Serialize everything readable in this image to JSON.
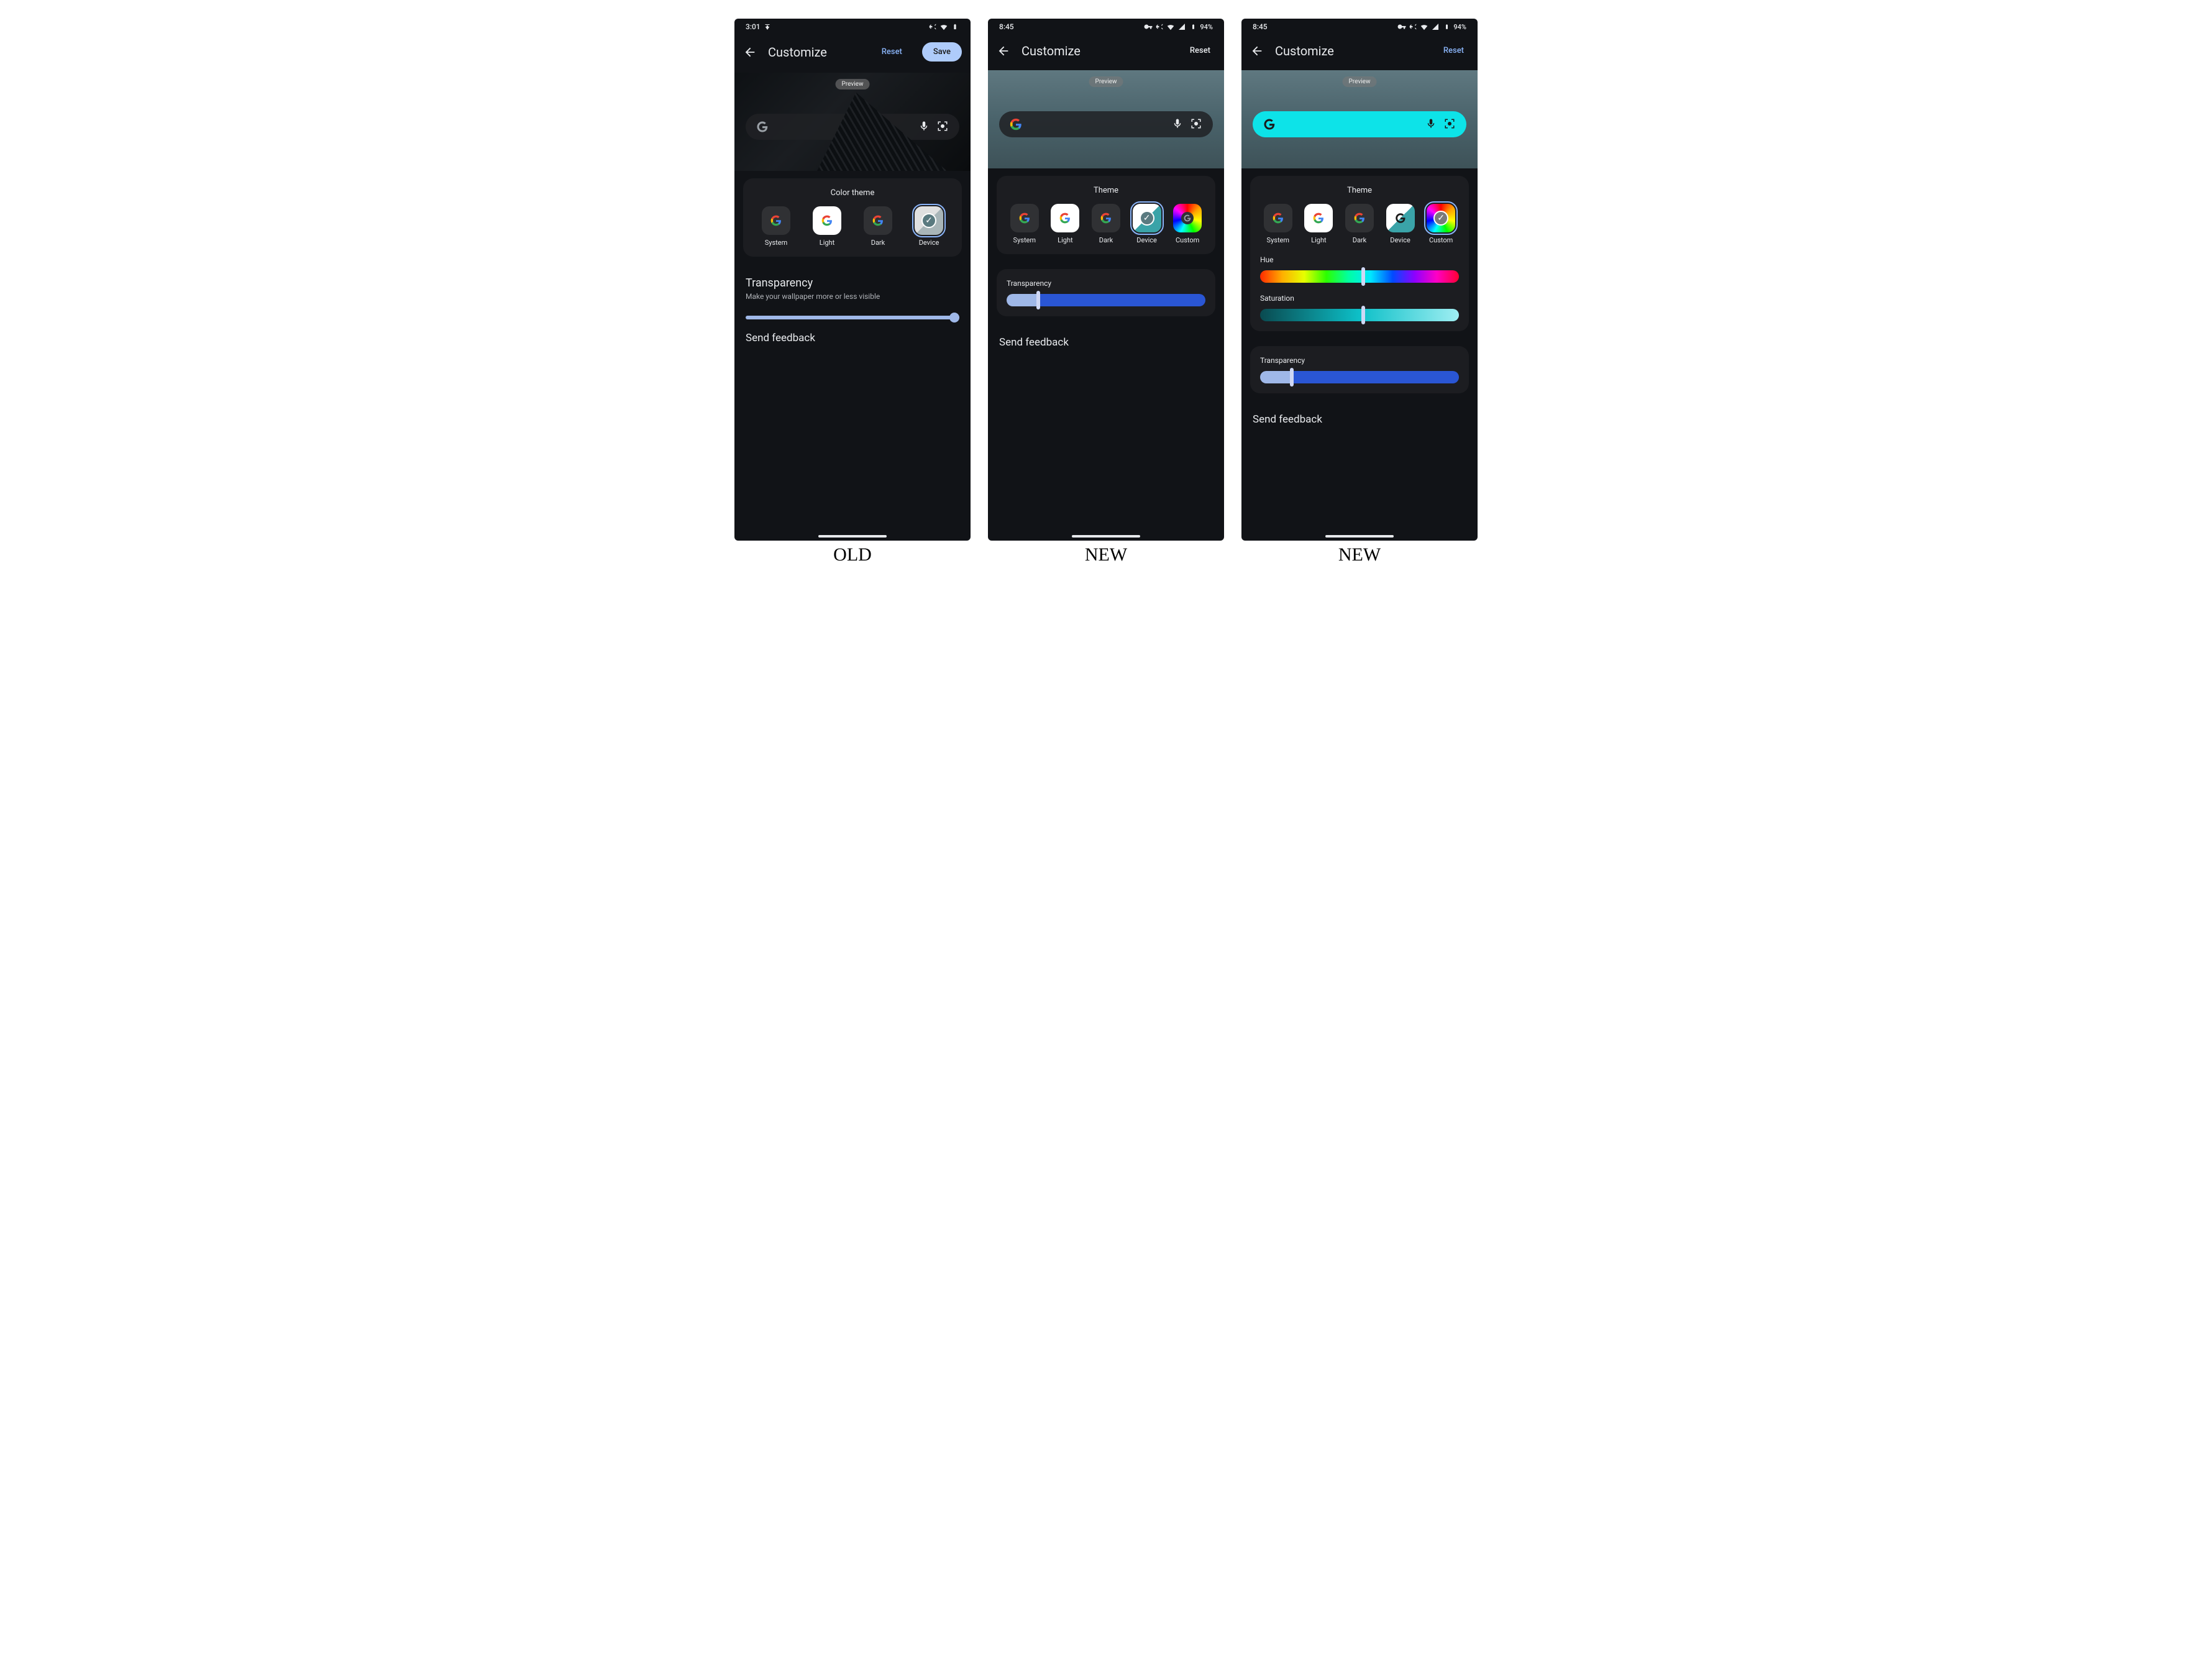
{
  "captions": {
    "old": "OLD",
    "new": "NEW"
  },
  "status": {
    "old_time": "3:01",
    "new_time": "8:45",
    "battery_pct": "94%"
  },
  "appbar": {
    "title": "Customize",
    "reset": "Reset",
    "save": "Save"
  },
  "preview": {
    "chip": "Preview"
  },
  "theme": {
    "title_old": "Color theme",
    "title_new": "Theme",
    "options": {
      "system": "System",
      "light": "Light",
      "dark": "Dark",
      "device": "Device",
      "custom": "Custom"
    }
  },
  "transparency": {
    "title": "Transparency",
    "subtitle": "Make your wallpaper more or less visible"
  },
  "sliders": {
    "hue": "Hue",
    "saturation": "Saturation",
    "transparency": "Transparency"
  },
  "feedback": "Send feedback"
}
